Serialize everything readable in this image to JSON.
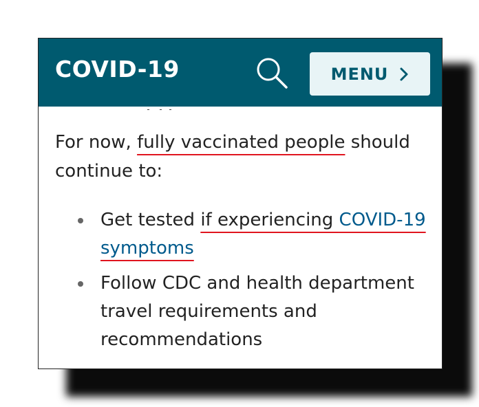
{
  "header": {
    "title": "COVID-19",
    "search_icon": "search-icon",
    "menu_label": "MENU",
    "menu_icon": "chevron-right-icon"
  },
  "colors": {
    "header_bg": "#005a6f",
    "menu_bg": "#e8f4f6",
    "link": "#005a8c",
    "annotation_underline": "#e0141e"
  },
  "content": {
    "intro_before": "For now, ",
    "intro_highlight": "fully vaccinated people",
    "intro_after": " should continue to:",
    "bullets": [
      {
        "text_before": "Get tested ",
        "text_highlight": "if experiencing ",
        "link_part1": "COVID-19",
        "link_part2": "symptoms"
      },
      {
        "text": "Follow CDC and health department travel requirements and recommendations"
      }
    ]
  }
}
